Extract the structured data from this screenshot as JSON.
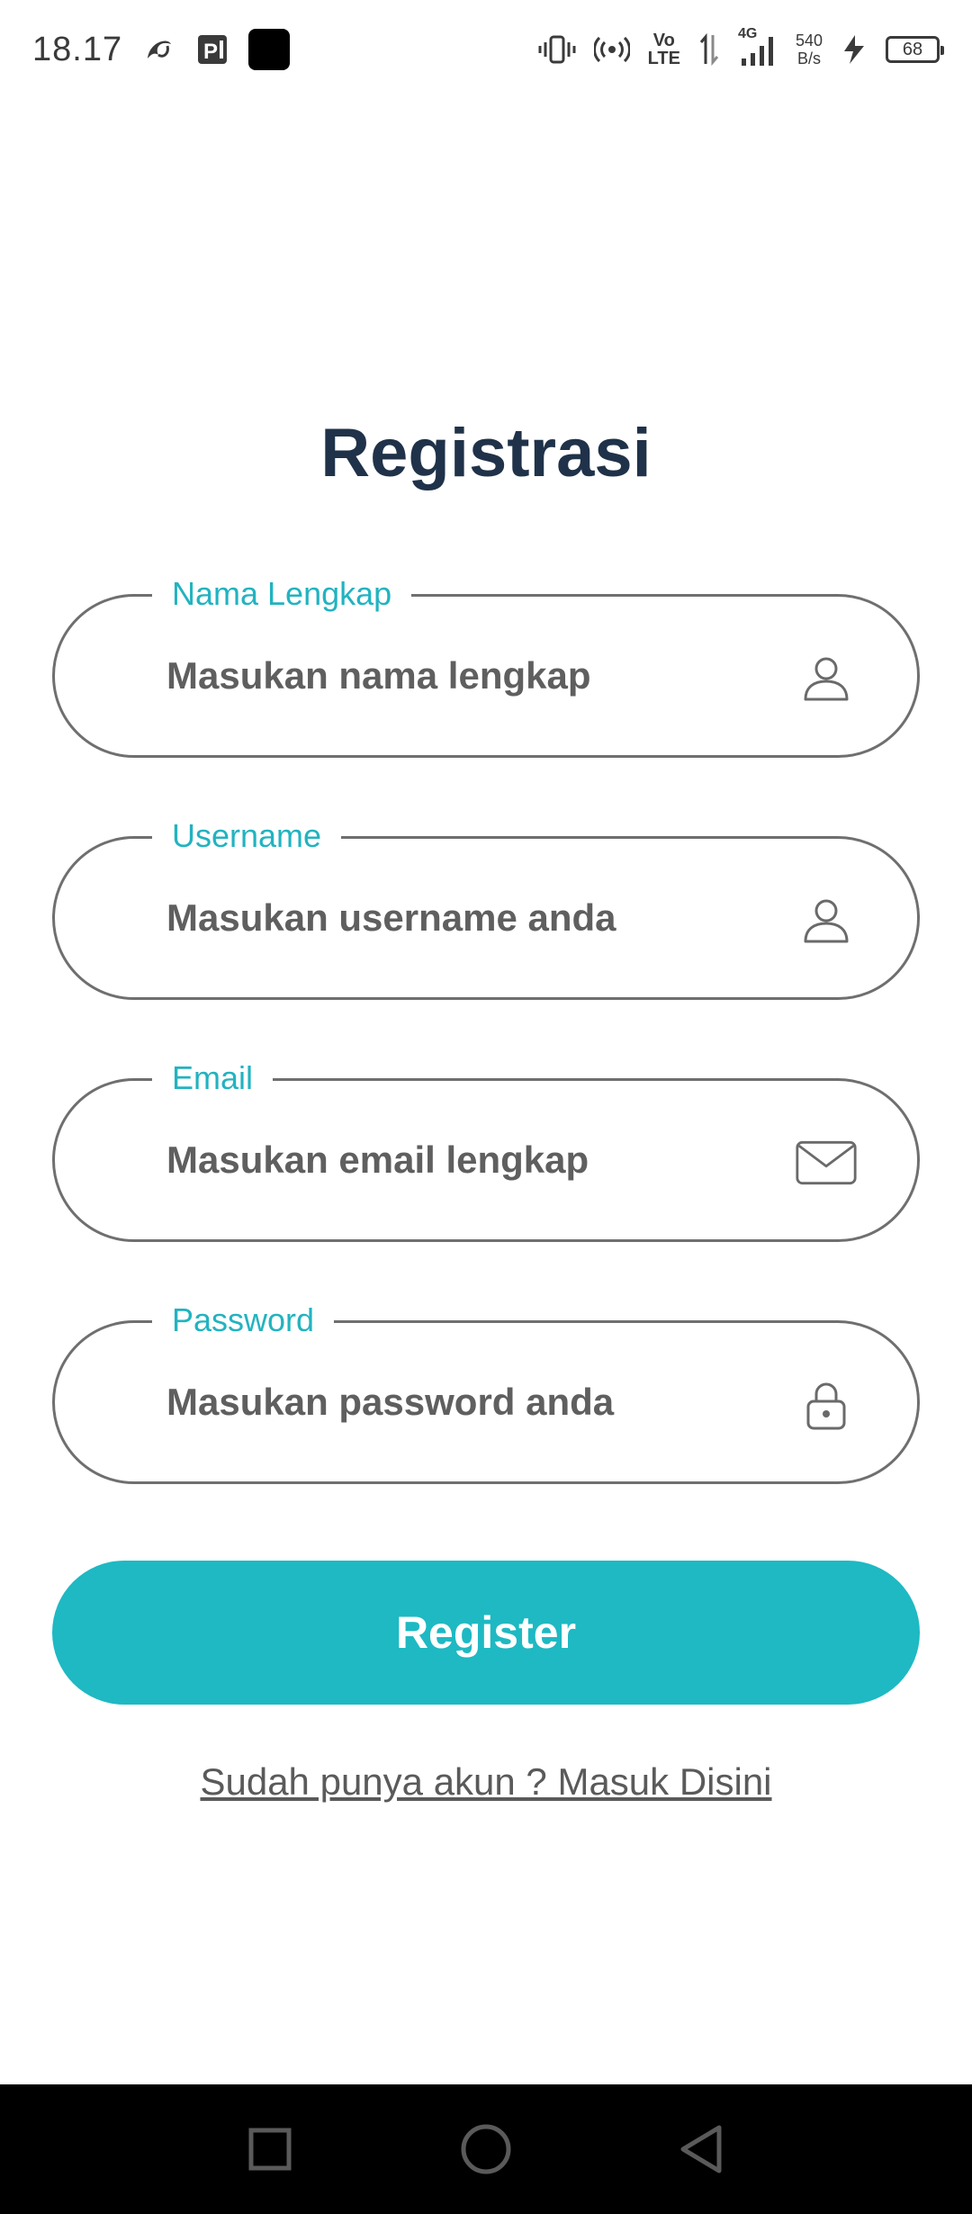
{
  "status_bar": {
    "time": "18.17",
    "network_type": "4G",
    "volte_top": "Vo",
    "volte_bottom": "LTE",
    "speed_value": "540",
    "speed_unit": "B/s",
    "battery_level": "68",
    "icons": [
      "swirl-app-icon",
      "parking-app-icon",
      "black-square-icon",
      "vibrate-icon",
      "hotspot-icon",
      "volte-icon",
      "data-arrows-icon",
      "signal-icon",
      "charging-icon",
      "battery-icon"
    ]
  },
  "title": "Registrasi",
  "fields": [
    {
      "label": "Nama Lengkap",
      "placeholder": "Masukan nama lengkap",
      "icon": "user-icon"
    },
    {
      "label": "Username",
      "placeholder": "Masukan username anda",
      "icon": "user-icon"
    },
    {
      "label": "Email",
      "placeholder": "Masukan email lengkap",
      "icon": "mail-icon"
    },
    {
      "label": "Password",
      "placeholder": "Masukan password anda",
      "icon": "lock-icon"
    }
  ],
  "register_label": "Register",
  "login_link": "Sudah punya akun ? Masuk Disini",
  "colors": {
    "accent": "#1eb9c3",
    "label": "#22b3c0",
    "title": "#1f3249",
    "border": "#6f6f6f",
    "nav_bar": "#000000"
  },
  "nav": {
    "buttons": [
      "recent-apps-icon",
      "home-icon",
      "back-icon"
    ]
  }
}
